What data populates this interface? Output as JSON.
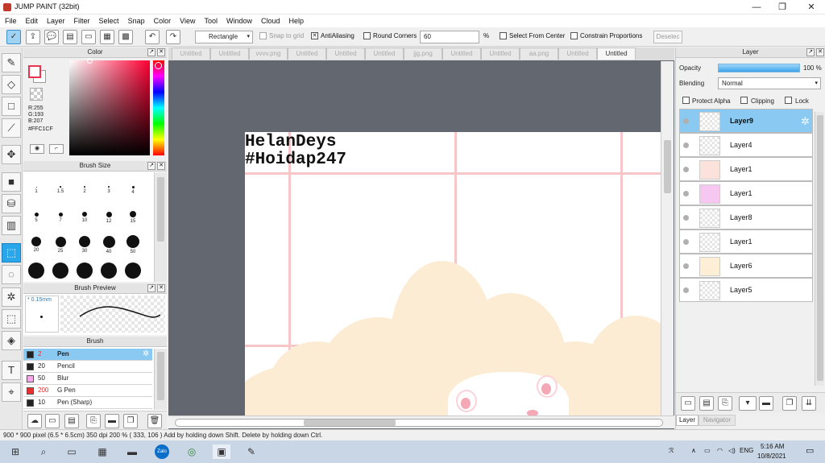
{
  "window": {
    "title": "JUMP PAINT (32bit)",
    "min": "—",
    "restore": "❐",
    "close": "✕"
  },
  "menu": [
    "File",
    "Edit",
    "Layer",
    "Filter",
    "Select",
    "Snap",
    "Color",
    "View",
    "Tool",
    "Window",
    "Cloud",
    "Help"
  ],
  "toolbar": {
    "shape": "Rectangle",
    "snap_to_grid": "Snap to grid",
    "antialiasing": "AntiAliasing",
    "round_corners": "Round Corners",
    "round_value": "60",
    "percent": "%",
    "select_from_center": "Select From Center",
    "constrain": "Constrain Proportions",
    "deselect": "Deselec"
  },
  "color_panel": {
    "title": "Color",
    "r": "R:255",
    "g": "G:193",
    "b": "B:207",
    "hex": "#FFC1CF",
    "front_color": "#e8344e"
  },
  "brush_size_panel": {
    "title": "Brush Size",
    "sizes": [
      "1",
      "1.5",
      "2",
      "3",
      "4",
      "5",
      "7",
      "10",
      "12",
      "15",
      "20",
      "25",
      "30",
      "40",
      "50"
    ]
  },
  "brush_preview_panel": {
    "title": "Brush Preview",
    "size": "* 0.15mm"
  },
  "brush_panel": {
    "title": "Brush",
    "items": [
      {
        "num": "2",
        "name": "Pen",
        "color": "#222222"
      },
      {
        "num": "20",
        "name": "Pencil",
        "color": "#222222"
      },
      {
        "num": "50",
        "name": "Blur",
        "color": "#f7a8e8"
      },
      {
        "num": "200",
        "name": "G Pen",
        "color": "#e83030"
      },
      {
        "num": "10",
        "name": "Pen (Sharp)",
        "color": "#222222"
      }
    ]
  },
  "tabs": [
    "Untitled",
    "Untitled",
    "vvvv.png",
    "Untitled",
    "Untitled",
    "Untitled",
    "jjg.png",
    "Untitled",
    "Untitled",
    "aa.png",
    "Untitled",
    "Untitled"
  ],
  "canvas": {
    "watermark_line1": "HelanDeys",
    "watermark_line2": "#Hoidap247"
  },
  "layer_panel": {
    "title": "Layer",
    "opacity_label": "Opacity",
    "opacity_value": "100 %",
    "blending_label": "Blending",
    "blending_value": "Normal",
    "protect_alpha": "Protect Alpha",
    "clipping": "Clipping",
    "lock": "Lock",
    "layers": [
      "Layer9",
      "Layer4",
      "Layer1",
      "Layer1",
      "Layer8",
      "Layer1",
      "Layer6",
      "Layer5"
    ],
    "tab_layer": "Layer",
    "tab_navigator": "Navigator"
  },
  "statusbar": {
    "text": "900 * 900 pixel   (6.5 * 6.5cm)   350 dpi   200 %   ( 333, 106 )   Add by holding down Shift. Delete by holding down Ctrl."
  },
  "taskbar": {
    "lang": "ENG",
    "time": "5:16 AM",
    "date": "10/8/2021"
  }
}
